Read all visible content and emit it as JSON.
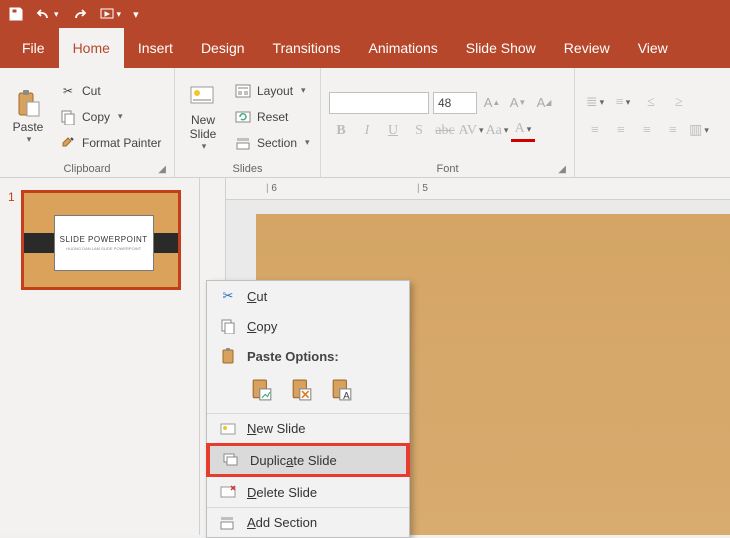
{
  "qat": {
    "save": "Save",
    "undo": "Undo",
    "redo": "Redo",
    "start_from_beginning": "Start From Beginning"
  },
  "tabs": {
    "file": "File",
    "home": "Home",
    "insert": "Insert",
    "design": "Design",
    "transitions": "Transitions",
    "animations": "Animations",
    "slide_show": "Slide Show",
    "review": "Review",
    "view": "View"
  },
  "ribbon": {
    "clipboard": {
      "label": "Clipboard",
      "paste": "Paste",
      "cut": "Cut",
      "copy": "Copy",
      "format_painter": "Format Painter"
    },
    "slides": {
      "label": "Slides",
      "new_slide": "New\nSlide",
      "layout": "Layout",
      "reset": "Reset",
      "section": "Section"
    },
    "font": {
      "label": "Font",
      "font_name": "",
      "font_size": "48"
    }
  },
  "thumb": {
    "number": "1",
    "title": "SLIDE POWERPOINT",
    "subtitle": "HUONG DAN LAM SLIDE POWERPOINT"
  },
  "ruler_ticks": [
    "6",
    "5"
  ],
  "context_menu": {
    "cut": "Cut",
    "copy": "Copy",
    "paste_options": "Paste Options:",
    "new_slide": "New Slide",
    "duplicate_slide": "Duplicate Slide",
    "delete_slide": "Delete Slide",
    "add_section": "Add Section"
  }
}
